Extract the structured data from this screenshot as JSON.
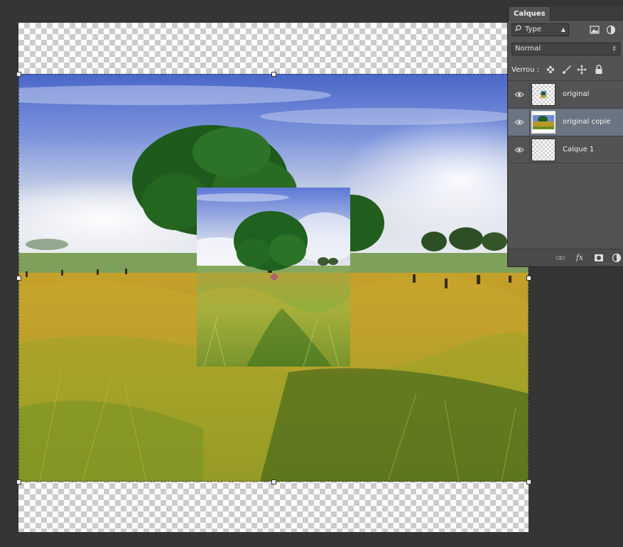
{
  "layers_panel": {
    "tab_label": "Calques",
    "filter_kind": "Type",
    "blend_mode": "Normal",
    "lock_label": "Verrou :",
    "layers": [
      {
        "name": "original",
        "visible": true,
        "selected": false
      },
      {
        "name": "original copie",
        "visible": true,
        "selected": true
      },
      {
        "name": "Calque 1",
        "visible": true,
        "selected": false
      }
    ],
    "footer_icons": [
      "link-icon",
      "fx-icon",
      "mask-icon",
      "adjustment-icon"
    ],
    "footer_fx_label": "fx"
  },
  "colors": {
    "workspace": "#353535",
    "panel": "#535353",
    "selected_layer": "#6b7481"
  }
}
